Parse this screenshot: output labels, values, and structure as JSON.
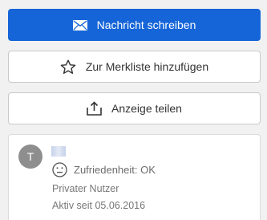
{
  "actions": {
    "message": {
      "label": "Nachricht schreiben",
      "icon": "envelope-icon"
    },
    "watchlist": {
      "label": "Zur Merkliste hinzufügen",
      "icon": "star-outline-icon"
    },
    "share": {
      "label": "Anzeige teilen",
      "icon": "share-icon"
    }
  },
  "seller": {
    "avatar_initial": "T",
    "satisfaction": {
      "label": "Zufriedenheit: OK",
      "icon": "neutral-face-icon"
    },
    "type": "Privater Nutzer",
    "active_since": "Aktiv seit 05.06.2016"
  },
  "colors": {
    "primary": "#1565d8",
    "avatar_bg": "#8e8e8e",
    "page_bg": "#f1f1f1"
  }
}
